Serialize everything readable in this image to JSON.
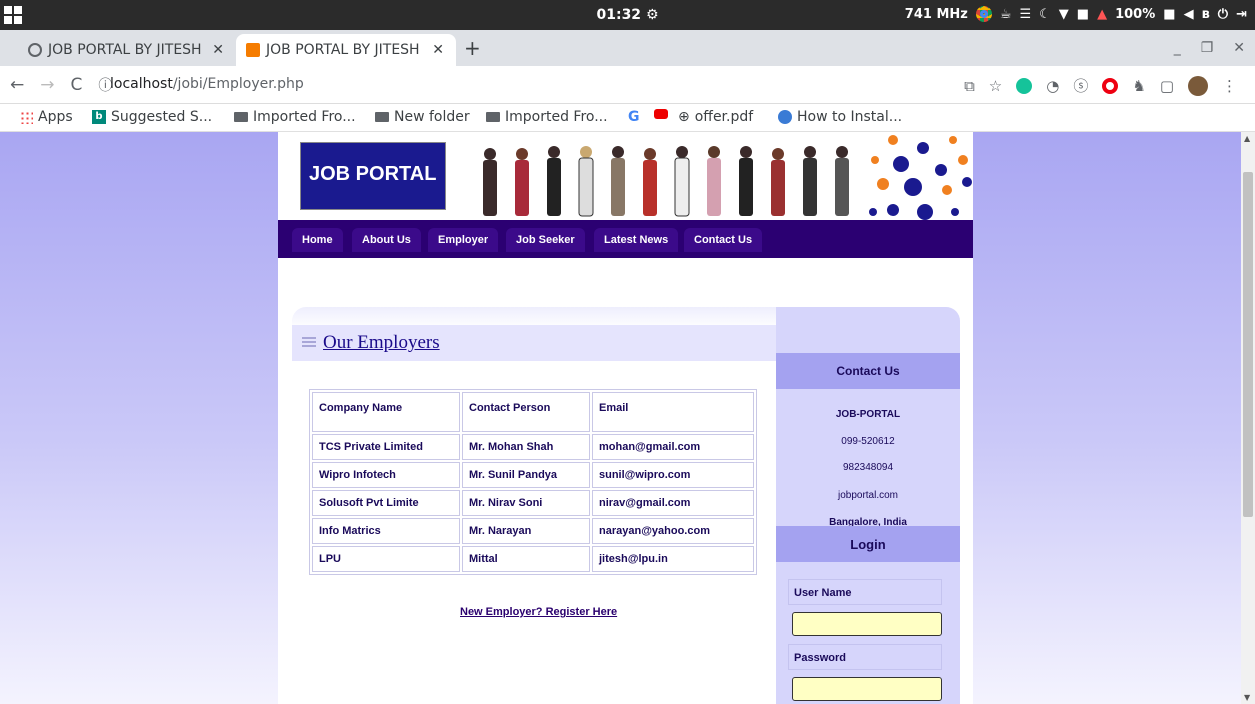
{
  "os": {
    "clock": "01:32",
    "status": "741 MHz",
    "battery": "100%"
  },
  "browser": {
    "tabs": [
      {
        "label": "JOB PORTAL BY JITESH"
      },
      {
        "label": "JOB PORTAL BY JITESH"
      }
    ],
    "url_host": "localhost",
    "url_path": "/jobi/Employer.php",
    "bookmarks": [
      {
        "label": "Apps"
      },
      {
        "label": "Suggested S..."
      },
      {
        "label": "Imported Fro..."
      },
      {
        "label": "New folder"
      },
      {
        "label": "Imported Fro..."
      },
      {
        "label": "offer.pdf"
      },
      {
        "label": "How to Instal..."
      }
    ]
  },
  "site": {
    "logo": "JOB PORTAL",
    "nav": [
      "Home",
      "About Us",
      "Employer",
      "Job Seeker",
      "Latest News",
      "Contact Us"
    ]
  },
  "main": {
    "title": "Our Employers",
    "headers": [
      "Company Name",
      "Contact Person",
      "Email"
    ],
    "rows": [
      [
        "TCS Private Limited",
        "Mr. Mohan Shah",
        "mohan@gmail.com"
      ],
      [
        "Wipro Infotech",
        "Mr. Sunil Pandya",
        "sunil@wipro.com"
      ],
      [
        "Solusoft Pvt Limite",
        "Mr. Nirav Soni",
        "nirav@gmail.com"
      ],
      [
        "Info Matrics",
        "Mr. Narayan",
        "narayan@yahoo.com"
      ],
      [
        "LPU",
        "Mittal",
        "jitesh@lpu.in"
      ]
    ],
    "register_link": "New Employer? Register Here"
  },
  "sidebar": {
    "contact_title": "Contact Us",
    "contact_lines": [
      "JOB-PORTAL",
      "099-520612",
      "982348094",
      "jobportal.com",
      "Bangalore, India"
    ],
    "login_title": "Login",
    "username_label": "User Name",
    "password_label": "Password"
  }
}
